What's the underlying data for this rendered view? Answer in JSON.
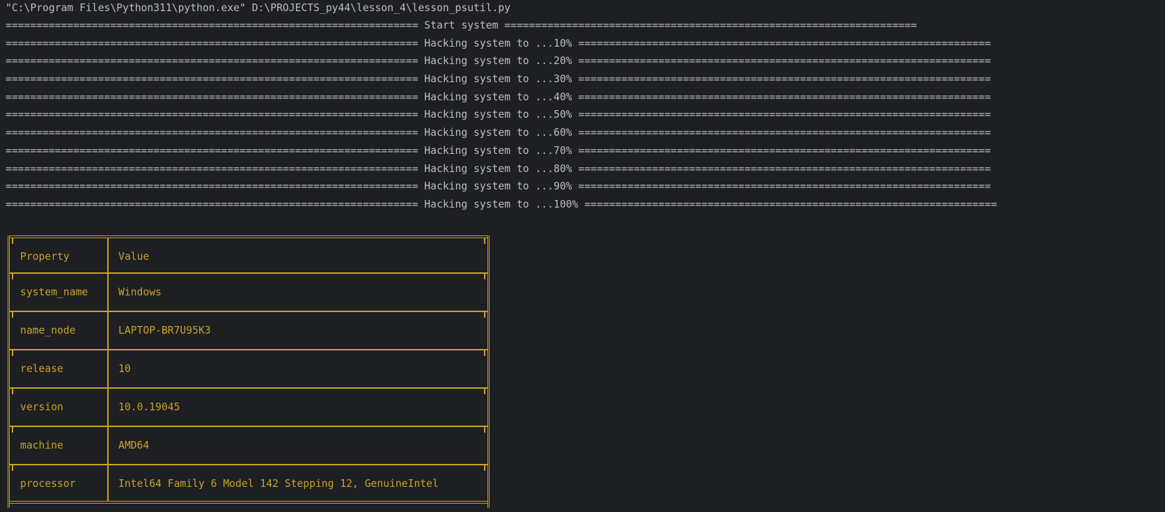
{
  "console": {
    "command": "\"C:\\Program Files\\Python311\\python.exe\" D:\\PROJECTS_py44\\lesson_4\\lesson_psutil.py",
    "lines": [
      "=================================================================== Start system ===================================================================",
      "=================================================================== Hacking system to ...10% ===================================================================",
      "=================================================================== Hacking system to ...20% ===================================================================",
      "=================================================================== Hacking system to ...30% ===================================================================",
      "=================================================================== Hacking system to ...40% ===================================================================",
      "=================================================================== Hacking system to ...50% ===================================================================",
      "=================================================================== Hacking system to ...60% ===================================================================",
      "=================================================================== Hacking system to ...70% ===================================================================",
      "=================================================================== Hacking system to ...80% ===================================================================",
      "=================================================================== Hacking system to ...90% ===================================================================",
      "=================================================================== Hacking system to ...100% ==================================================================="
    ]
  },
  "table": {
    "header": {
      "property": "Property",
      "value": "Value"
    },
    "rows": [
      {
        "property": "system_name",
        "value": "Windows"
      },
      {
        "property": "name_node",
        "value": "LAPTOP-BR7U95K3"
      },
      {
        "property": "release",
        "value": "10"
      },
      {
        "property": "version",
        "value": "10.0.19045"
      },
      {
        "property": "machine",
        "value": "AMD64"
      },
      {
        "property": "processor",
        "value": "Intel64 Family 6 Model 142 Stepping 12, GenuineIntel"
      }
    ]
  },
  "colors": {
    "background": "#1e1f22",
    "text": "#bcbec4",
    "table": "#c9a227"
  }
}
